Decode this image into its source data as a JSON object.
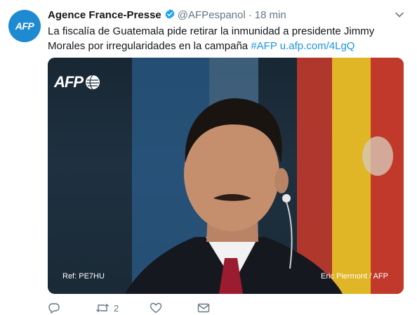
{
  "tweet": {
    "author": {
      "name": "Agence France-Presse",
      "handle": "@AFPespanol",
      "avatar_text": "AFP",
      "verified": true
    },
    "separator": "·",
    "time": "18 min",
    "text": "La fiscalía de Guatemala pide retirar la inmunidad a presidente Jimmy Morales por irregularidades en la campaña",
    "hashtag": "#AFP",
    "link": "u.afp.com/4LgQ",
    "media": {
      "logo_text": "AFP",
      "ref": "Ref: PE7HU",
      "credit": "Eric Piermont / AFP"
    },
    "actions": {
      "reply_count": "",
      "retweet_count": "2",
      "like_count": "",
      "dm_count": ""
    }
  },
  "colors": {
    "link": "#1b95e0",
    "muted": "#657786",
    "verified": "#1da1f2",
    "avatar_bg": "#1d8ad1"
  },
  "icons": [
    "chevron-down-icon",
    "verified-badge-icon",
    "reply-icon",
    "retweet-icon",
    "like-icon",
    "message-icon"
  ]
}
